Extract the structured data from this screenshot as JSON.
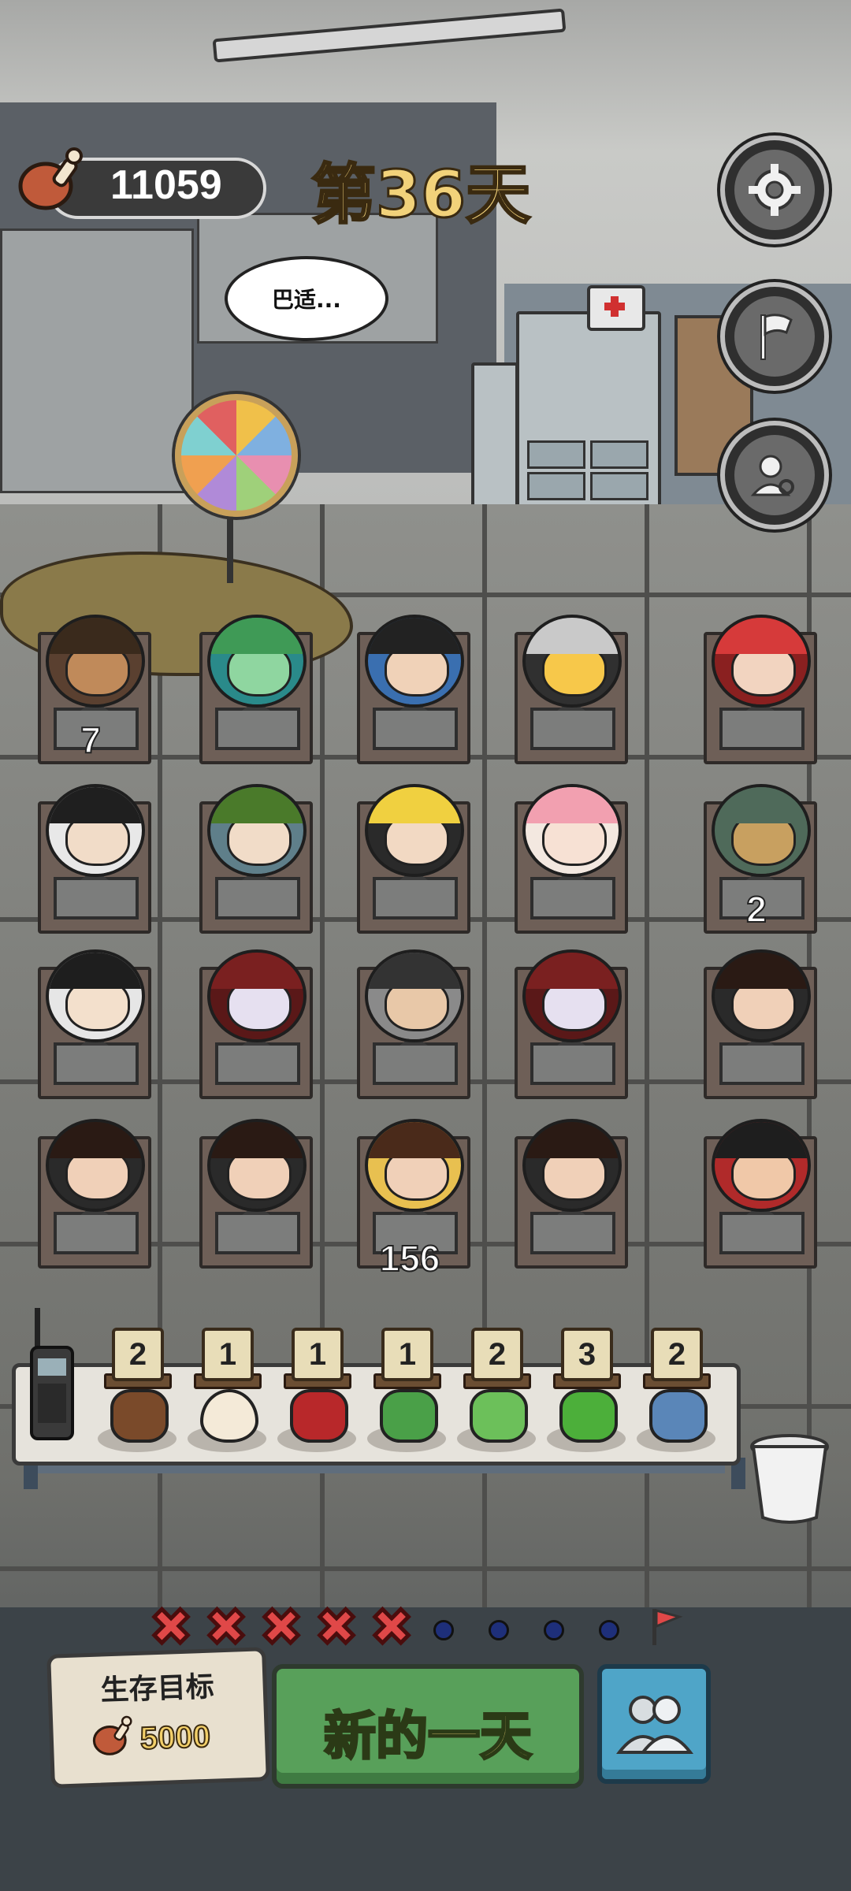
{
  "hud": {
    "currency_value": "11059",
    "currency_icon": "meat-drumstick-icon",
    "day_label": "第36天"
  },
  "side_buttons": [
    {
      "icon": "gear-icon"
    },
    {
      "icon": "flag-icon"
    },
    {
      "icon": "person-search-icon"
    }
  ],
  "speech_bubble": "巴适...",
  "grid": [
    {
      "count": "7",
      "hair": "#3a2a1c",
      "skin": "#c08a5a",
      "body": "#5a4030"
    },
    {
      "count": "",
      "hair": "#3f9a56",
      "skin": "#8fd6a0",
      "body": "#2a8a8a"
    },
    {
      "count": "",
      "hair": "#222222",
      "skin": "#f0d2b8",
      "body": "#3a6fb0"
    },
    {
      "count": "",
      "hair": "#c9c9c9",
      "skin": "#f7c84a",
      "body": "#303030"
    },
    {
      "count": "",
      "hair": "#d63a3a",
      "skin": "#f2d4c0",
      "body": "#8a2020"
    },
    {
      "count": "",
      "hair": "#1f1f1f",
      "skin": "#f1dcc8",
      "body": "#e8e8e8"
    },
    {
      "count": "",
      "hair": "#4a7a2a",
      "skin": "#f1dcc8",
      "body": "#5f7f8a"
    },
    {
      "count": "",
      "hair": "#f0d040",
      "skin": "#f2d9c3",
      "body": "#2a2a2a"
    },
    {
      "count": "",
      "hair": "#f2a0b0",
      "skin": "#f7e1d4",
      "body": "#f3e8e0"
    },
    {
      "count": "2",
      "hair": "#4f6a5a",
      "skin": "#c8a060",
      "body": "#4f6a5a"
    },
    {
      "count": "",
      "hair": "#1e1e1e",
      "skin": "#f3e0cc",
      "body": "#e6e6e6"
    },
    {
      "count": "",
      "hair": "#7a2020",
      "skin": "#e6e0f0",
      "body": "#5a1818"
    },
    {
      "count": "",
      "hair": "#333333",
      "skin": "#e8c8a8",
      "body": "#8a8a8a"
    },
    {
      "count": "",
      "hair": "#7a2020",
      "skin": "#e6e0f0",
      "body": "#5a1818"
    },
    {
      "count": "",
      "hair": "#2a1a14",
      "skin": "#f0d0b8",
      "body": "#2a2a2a"
    },
    {
      "count": "",
      "hair": "#2a1a14",
      "skin": "#f0d0b8",
      "body": "#2a2a2a"
    },
    {
      "count": "",
      "hair": "#2a1a14",
      "skin": "#f0d0b8",
      "body": "#2a2a2a"
    },
    {
      "count": "156",
      "hair": "#4a2a1a",
      "skin": "#f0d0b8",
      "body": "#e8c050"
    },
    {
      "count": "",
      "hair": "#2a1a14",
      "skin": "#f0d0b8",
      "body": "#2a2a2a"
    },
    {
      "count": "",
      "hair": "#1e1e1e",
      "skin": "#f0c8a8",
      "body": "#b02a2a"
    }
  ],
  "items": [
    {
      "count": "2",
      "icon": "chestnuts-icon",
      "color": "#7a4a2a"
    },
    {
      "count": "1",
      "icon": "egg-icon",
      "color": "#f4ead8"
    },
    {
      "count": "1",
      "icon": "raw-meat-icon",
      "color": "#b8282a"
    },
    {
      "count": "1",
      "icon": "watermelon-icon",
      "color": "#4aa048"
    },
    {
      "count": "2",
      "icon": "frog-icon",
      "color": "#6cc05a"
    },
    {
      "count": "3",
      "icon": "herb-leaves-icon",
      "color": "#4caf3a"
    },
    {
      "count": "2",
      "icon": "water-barrel-icon",
      "color": "#5a86b8"
    }
  ],
  "progress": {
    "failed": 5,
    "remaining": 4,
    "end_icon": "red-flag-icon"
  },
  "goal": {
    "title": "生存目标",
    "value": "5000",
    "icon": "meat-drumstick-icon"
  },
  "new_day_label": "新的一天",
  "team_icon": "group-icon"
}
